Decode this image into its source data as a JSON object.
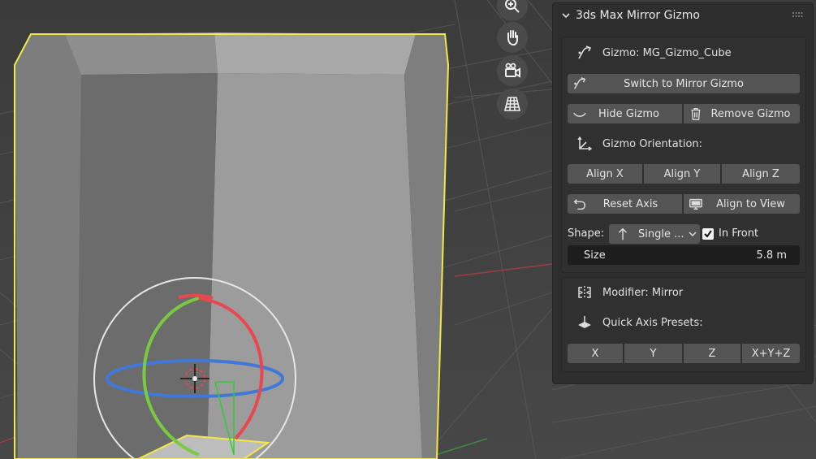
{
  "panel": {
    "title": "3ds Max Mirror Gizmo",
    "gizmo_label": "Gizmo: MG_Gizmo_Cube",
    "switch_button": "Switch to Mirror Gizmo",
    "hide_button": "Hide Gizmo",
    "remove_button": "Remove Gizmo",
    "orientation_label": "Gizmo Orientation:",
    "align_x": "Align X",
    "align_y": "Align Y",
    "align_z": "Align Z",
    "reset_axis": "Reset Axis",
    "align_view": "Align to View",
    "shape_label": "Shape:",
    "shape_value": "Single ...",
    "in_front_label": "In Front",
    "in_front_checked": true,
    "size_label": "Size",
    "size_value": "5.8 m",
    "modifier_label": "Modifier: Mirror",
    "presets_label": "Quick Axis Presets:",
    "preset_x": "X",
    "preset_y": "Y",
    "preset_z": "Z",
    "preset_xyz": "X+Y+Z"
  },
  "viewport_tools": [
    "zoom-icon",
    "hand-pan-icon",
    "camera-icon",
    "grid-icon"
  ],
  "colors": {
    "selection_outline": "#f2e84a",
    "axis_x": "#e8474f",
    "axis_y": "#7ac943",
    "axis_z": "#3f78d8"
  }
}
